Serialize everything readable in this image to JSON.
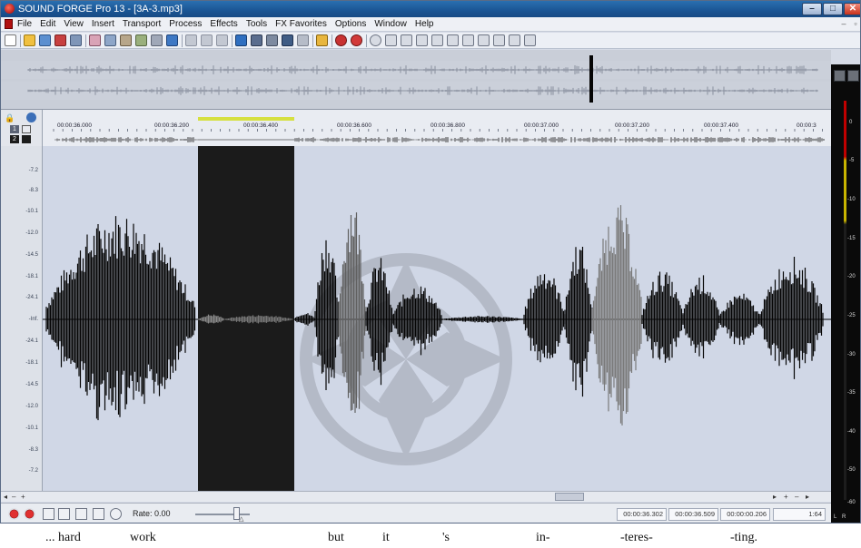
{
  "window": {
    "title": "SOUND FORGE Pro 13 - [3A-3.mp3]",
    "min_glyph": "–",
    "max_glyph": "□",
    "close_glyph": "✕"
  },
  "menu": [
    "File",
    "Edit",
    "View",
    "Insert",
    "Transport",
    "Process",
    "Effects",
    "Tools",
    "FX Favorites",
    "Options",
    "Window",
    "Help"
  ],
  "ruler": {
    "labels": [
      "00:00:36.000",
      "00:00:36.200",
      "00:00:36.400",
      "00:00:36.600",
      "00:00:36.800",
      "00:00:37.000",
      "00:00:37.200",
      "00:00:37.400",
      "00:00:3"
    ],
    "channel_numbers": [
      "1",
      "2"
    ]
  },
  "amplitude_scale": [
    "-7.2",
    "-8.3",
    "-10.1",
    "-12.0",
    "-14.5",
    "-18.1",
    "-24.1",
    "-Inf.",
    "-24.1",
    "-18.1",
    "-14.5",
    "-12.0",
    "-10.1",
    "-8.3",
    "-7.2"
  ],
  "meters": {
    "labels": [
      "0",
      "-5",
      "-10",
      "-15",
      "-20",
      "-25",
      "-30",
      "-35",
      "-40",
      "-50",
      "-60"
    ],
    "footer": [
      "L",
      "R"
    ]
  },
  "transport": {
    "rate_label": "Rate: 0.00",
    "times": [
      "00:00:36.302",
      "00:00:36.509",
      "00:00:00.206"
    ],
    "zoom": "1:64"
  },
  "captions": [
    "... hard",
    "work",
    "but",
    "it",
    "'s",
    "in-",
    "-teres-",
    "-ting."
  ],
  "colors": {
    "selection": "#1b1b1b",
    "waveform": "#050505",
    "wave_background": "#d0d7e6",
    "selection_marker": "#d6e040",
    "titlebar": "#1b5594"
  }
}
